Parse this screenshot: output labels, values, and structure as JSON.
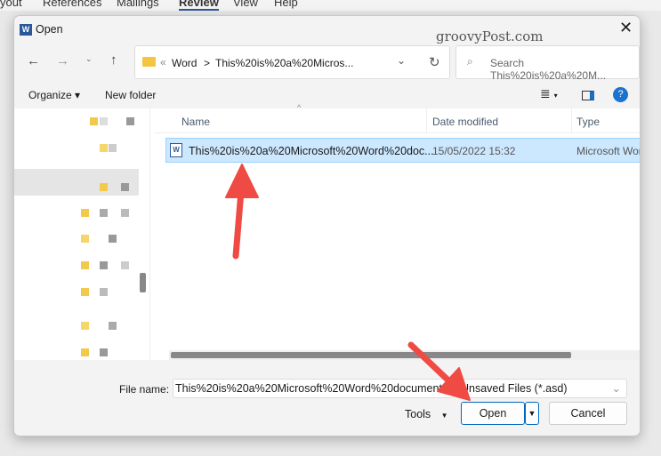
{
  "ribbon": {
    "tabs": [
      "yout",
      "References",
      "Mailings",
      "Review",
      "View",
      "Help"
    ]
  },
  "dialog": {
    "title": "Open",
    "watermark": "groovyPost.com",
    "address": {
      "prefix": "«",
      "folder": "Word",
      "sep": ">",
      "current": "This%20is%20a%20Micros..."
    },
    "search_placeholder": "Search This%20is%20a%20M...",
    "toolbar": {
      "organize": "Organize ▾",
      "new_folder": "New folder",
      "help": "?"
    },
    "columns": {
      "name": "Name",
      "date": "Date modified",
      "type": "Type"
    },
    "files": [
      {
        "name": "This%20is%20a%20Microsoft%20Word%20doc...",
        "date": "15/05/2022 15:32",
        "type": "Microsoft Wor"
      }
    ],
    "file_name_label": "File name:",
    "file_name_value": "This%20is%20a%20Microsoft%20Word%20document((",
    "file_type": "Unsaved Files (*.asd)",
    "tools": "Tools",
    "open": "Open",
    "cancel": "Cancel"
  },
  "colors": {
    "accent": "#0067c0",
    "selected": "#cce8ff",
    "arrow": "#ef4a43"
  }
}
